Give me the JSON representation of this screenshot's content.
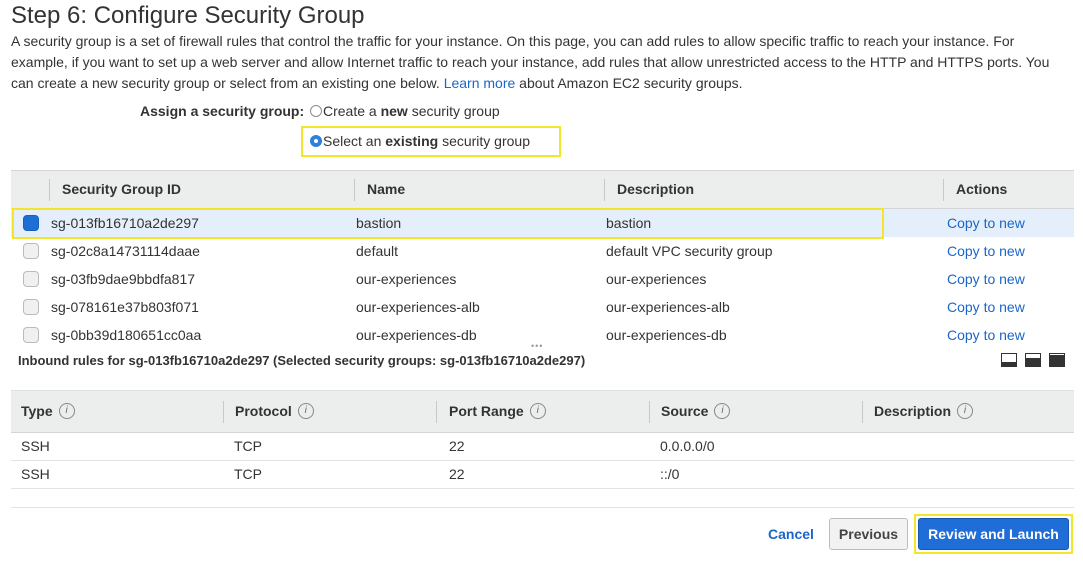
{
  "page": {
    "title": "Step 6: Configure Security Group",
    "intro_text": "A security group is a set of firewall rules that control the traffic for your instance. On this page, you can add rules to allow specific traffic to reach your instance. For example, if you want to set up a web server and allow Internet traffic to reach your instance, add rules that allow unrestricted access to the HTTP and HTTPS ports. You can create a new security group or select from an existing one below.",
    "learn_more": "Learn more",
    "intro_suffix": "about Amazon EC2 security groups."
  },
  "assign": {
    "label": "Assign a security group:",
    "option_new": {
      "prefix": "Create a ",
      "bold": "new",
      "suffix": " security group",
      "checked": false
    },
    "option_existing": {
      "prefix": "Select an ",
      "bold": "existing",
      "suffix": " security group",
      "checked": true
    }
  },
  "sg_table": {
    "columns": [
      "Security Group ID",
      "Name",
      "Description",
      "Actions"
    ],
    "rows": [
      {
        "id": "sg-013fb16710a2de297",
        "name": "bastion",
        "description": "bastion",
        "action": "Copy to new",
        "selected": true
      },
      {
        "id": "sg-02c8a14731114daae",
        "name": "default",
        "description": "default VPC security group",
        "action": "Copy to new",
        "selected": false
      },
      {
        "id": "sg-03fb9dae9bbdfa817",
        "name": "our-experiences",
        "description": "our-experiences",
        "action": "Copy to new",
        "selected": false
      },
      {
        "id": "sg-078161e37b803f071",
        "name": "our-experiences-alb",
        "description": "our-experiences-alb",
        "action": "Copy to new",
        "selected": false
      },
      {
        "id": "sg-0bb39d180651cc0aa",
        "name": "our-experiences-db",
        "description": "our-experiences-db",
        "action": "Copy to new",
        "selected": false
      }
    ]
  },
  "inbound": {
    "title": "Inbound rules for sg-013fb16710a2de297 (Selected security groups: sg-013fb16710a2de297)",
    "columns": [
      "Type",
      "Protocol",
      "Port Range",
      "Source",
      "Description"
    ],
    "rows": [
      {
        "type": "SSH",
        "protocol": "TCP",
        "port_range": "22",
        "source": "0.0.0.0/0",
        "description": ""
      },
      {
        "type": "SSH",
        "protocol": "TCP",
        "port_range": "22",
        "source": "::/0",
        "description": ""
      }
    ]
  },
  "buttons": {
    "cancel": "Cancel",
    "previous": "Previous",
    "review_launch": "Review and Launch"
  },
  "colors": {
    "link": "#1b66c9",
    "primary": "#1f6dd6",
    "highlight": "#f2e52a",
    "selected_row": "#e4effb"
  }
}
